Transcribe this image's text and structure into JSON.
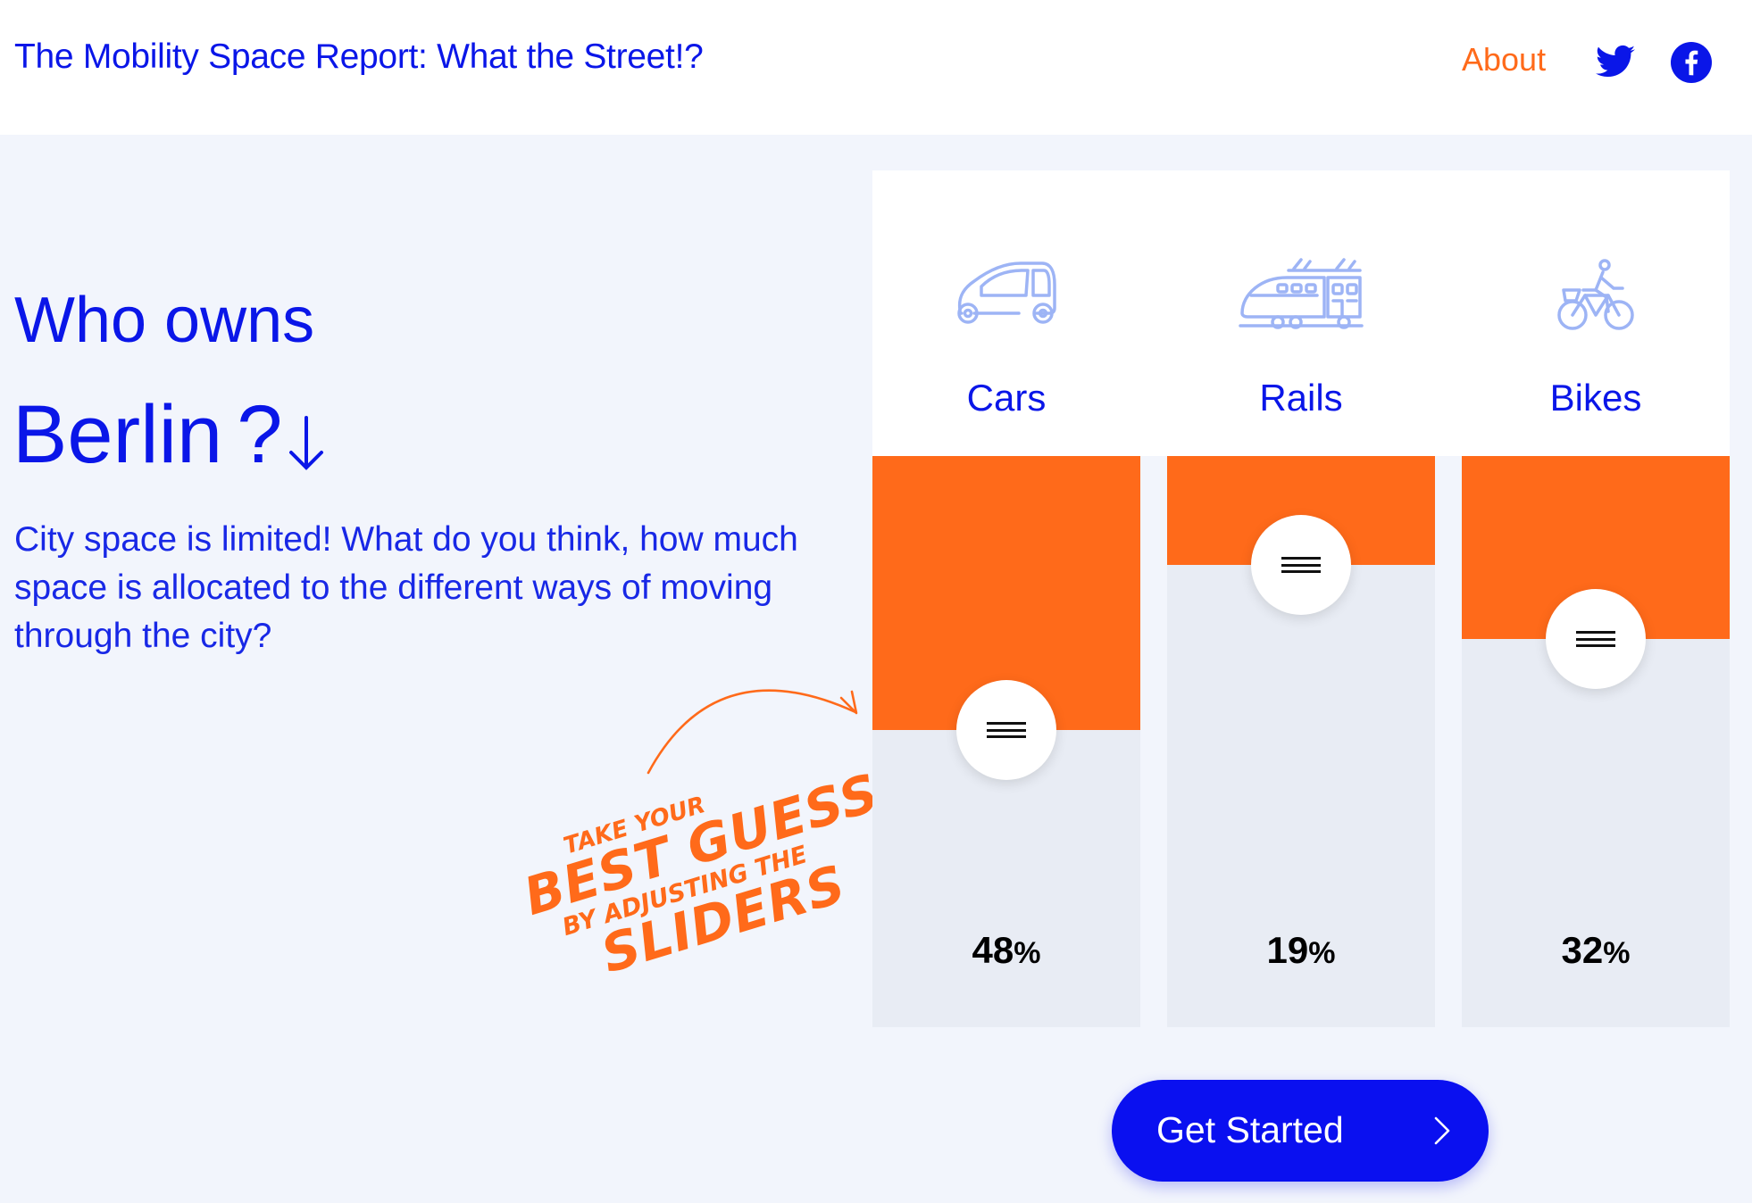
{
  "header": {
    "site_title": "The Mobility Space Report: What the Street!?",
    "about_label": "About",
    "social": [
      "twitter-icon",
      "facebook-icon"
    ]
  },
  "hero": {
    "who_owns": "Who owns",
    "city": "Berlin",
    "question_mark": "?",
    "lead": "City space is limited! What do you think, how much space is allocated to the different ways of moving through the city?"
  },
  "annotation": {
    "line1": "Take your",
    "line2": "Best guess",
    "line3": "by adjusting the",
    "line4": "Sliders"
  },
  "modes": [
    {
      "label": "Cars",
      "icon": "car-icon",
      "percent": 48,
      "percent_text": "48",
      "unit": "%"
    },
    {
      "label": "Rails",
      "icon": "tram-icon",
      "percent": 19,
      "percent_text": "19",
      "unit": "%"
    },
    {
      "label": "Bikes",
      "icon": "bicycle-icon",
      "percent": 32,
      "percent_text": "32",
      "unit": "%"
    }
  ],
  "cta": {
    "label": "Get Started"
  },
  "colors": {
    "brand_blue": "#0a16e8",
    "accent_orange": "#ff6a1a",
    "background": "#f2f5fc",
    "slider_track": "#e8ecf4",
    "icon_light_blue": "#9db4f5"
  }
}
